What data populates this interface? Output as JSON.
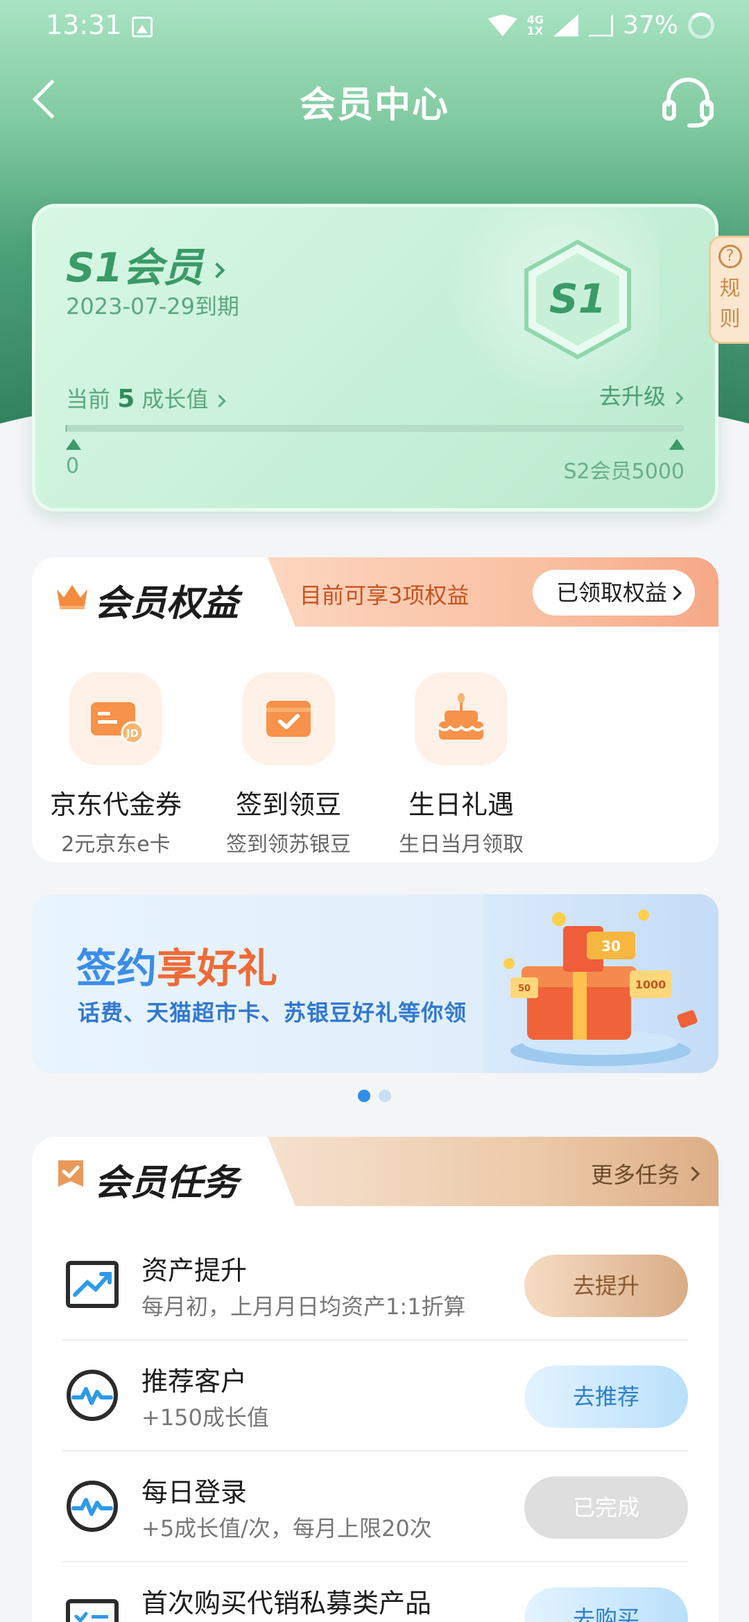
{
  "status_bar": {
    "time": "13:31",
    "network_label_top": "4G",
    "network_label_bottom": "1X",
    "battery": "37%"
  },
  "nav": {
    "title": "会员中心",
    "back_icon": "chevron-left-icon",
    "service_icon": "headset-icon"
  },
  "member_card": {
    "level_title": "S1会员",
    "expire_text": "2023-07-29到期",
    "badge_text": "S1",
    "growth_prefix": "当前",
    "growth_value": "5",
    "growth_suffix": "成长值",
    "upgrade_label": "去升级",
    "progress_fraction": 0.001,
    "progress_start": "0",
    "progress_end": "S2会员5000"
  },
  "rules_tab": {
    "icon": "?",
    "label_1": "规",
    "label_2": "则"
  },
  "benefits": {
    "title": "会员权益",
    "count_text": "目前可享3项权益",
    "claimed_button": "已领取权益",
    "items": [
      {
        "name": "京东代金券",
        "desc": "2元京东e卡",
        "icon": "jd-voucher-icon"
      },
      {
        "name": "签到领豆",
        "desc": "签到领苏银豆",
        "icon": "check-in-card-icon"
      },
      {
        "name": "生日礼遇",
        "desc": "生日当月领取",
        "icon": "birthday-cake-icon"
      }
    ]
  },
  "banner": {
    "title_part1": "签约",
    "title_part2": "享好礼",
    "subtitle": "话费、天猫超市卡、苏银豆好礼等你领",
    "art_labels": [
      "30",
      "50",
      "1000"
    ]
  },
  "tasks": {
    "title": "会员任务",
    "more_label": "更多任务",
    "items": [
      {
        "title": "资产提升",
        "desc": "每月初，上月月日均资产1:1折算",
        "button": "去提升",
        "icon": "chart-trend-icon",
        "style": "brown"
      },
      {
        "title": "推荐客户",
        "desc": "+150成长值",
        "button": "去推荐",
        "icon": "pulse-circle-icon",
        "style": "blue"
      },
      {
        "title": "每日登录",
        "desc": "+5成长值/次，每月上限20次",
        "button": "已完成",
        "icon": "pulse-circle-icon",
        "style": "done"
      },
      {
        "title": "首次购买代销私募类产品",
        "desc": "",
        "button": "去购买",
        "icon": "checklist-icon",
        "style": "blue"
      }
    ]
  },
  "colors": {
    "brand_green": "#3a9a68",
    "accent_orange": "#f06a35",
    "accent_blue": "#2f8ee8"
  }
}
